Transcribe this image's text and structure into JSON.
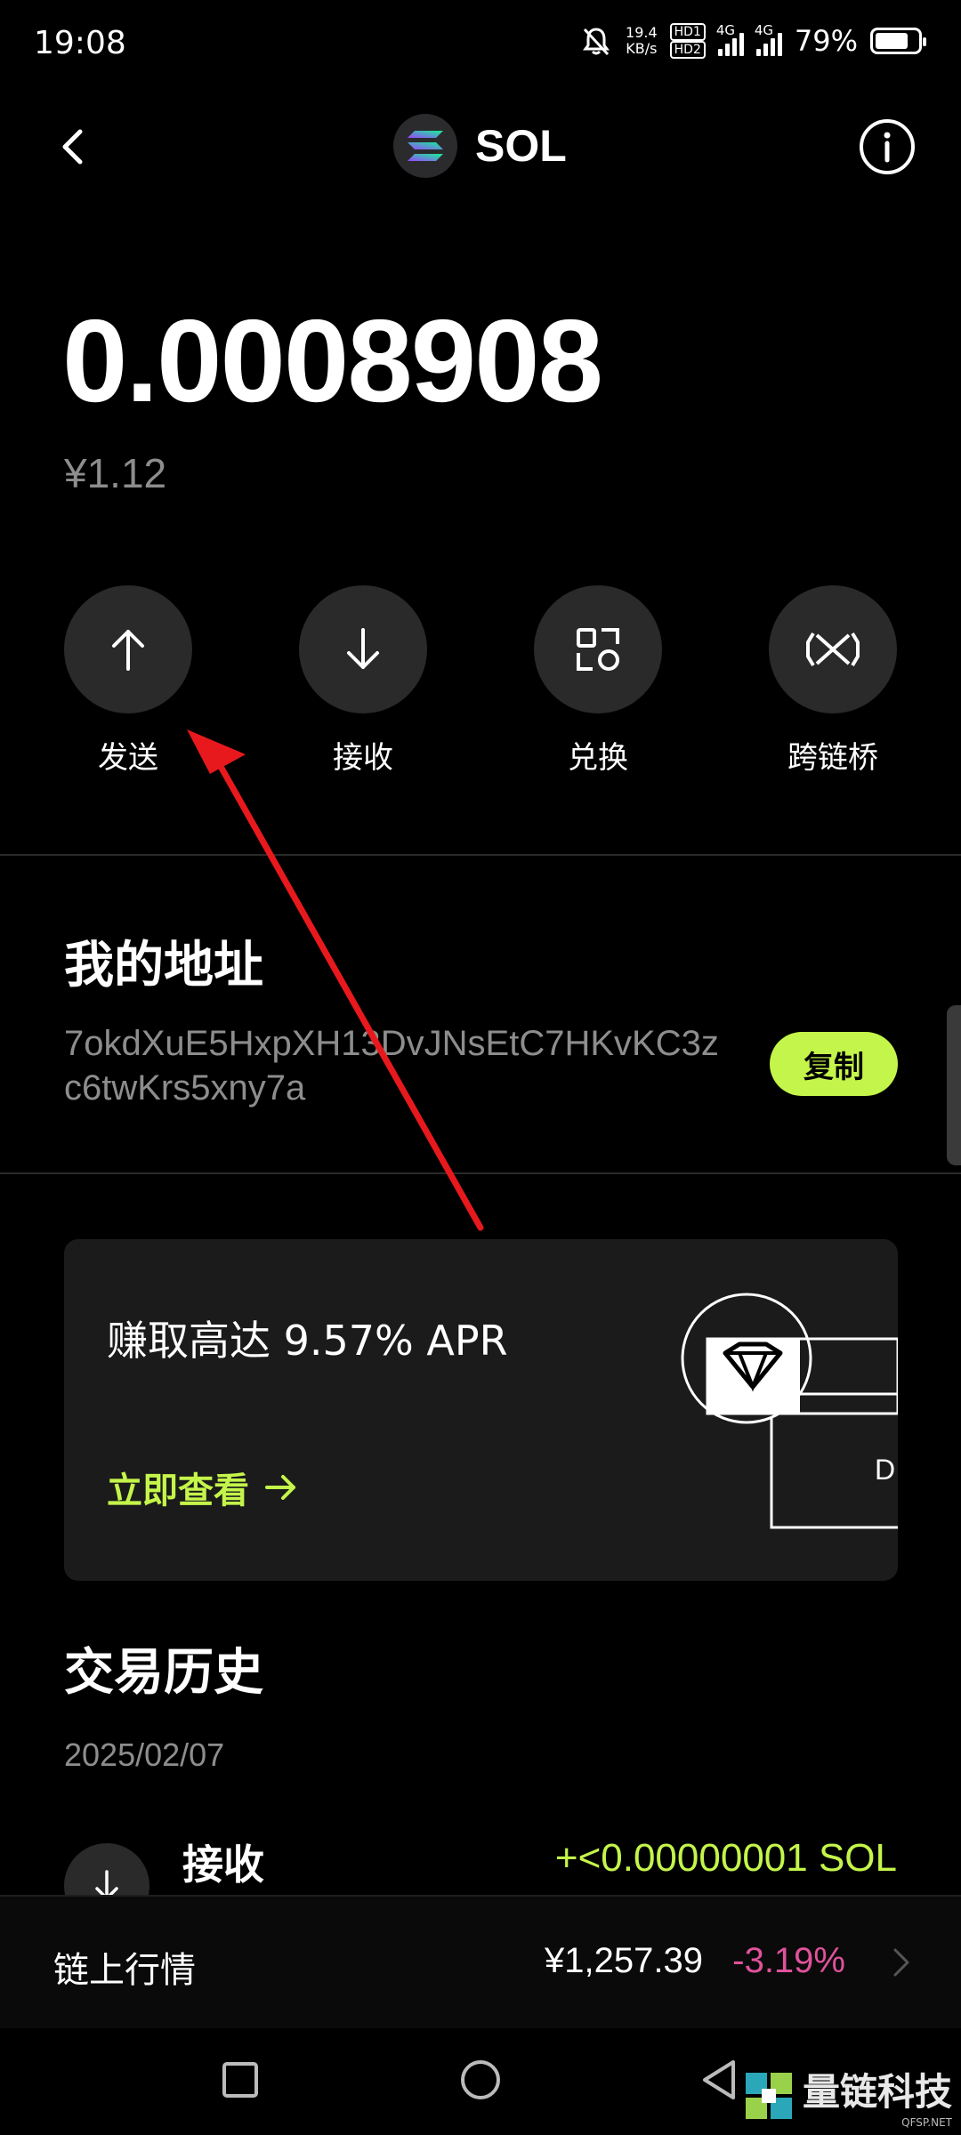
{
  "status_bar": {
    "time": "19:08",
    "net_speed_value": "19.4",
    "net_speed_unit": "KB/s",
    "hd_badge_1": "HD1",
    "hd_badge_2": "HD2",
    "sim1_type": "4G",
    "sim2_type": "4G",
    "battery_percent": "79%",
    "battery_level": 0.79
  },
  "header": {
    "title": "SOL",
    "back_icon": "chevron-left-icon",
    "info_icon": "info-icon",
    "logo_icon": "solana-logo-icon"
  },
  "balance": {
    "amount": "0.0008908",
    "fiat": "¥1.12"
  },
  "actions": [
    {
      "label": "发送",
      "icon": "arrow-up-icon"
    },
    {
      "label": "接收",
      "icon": "arrow-down-icon"
    },
    {
      "label": "兑换",
      "icon": "swap-icon"
    },
    {
      "label": "跨链桥",
      "icon": "bridge-icon"
    }
  ],
  "address": {
    "title": "我的地址",
    "value": "7okdXuE5HxpXH13DvJNsEtC7HKvKC3zc6twKrs5xny7a",
    "copy_label": "复制"
  },
  "promo": {
    "text": "赚取高达 9.57% APR",
    "link_label": "立即查看",
    "art_icon": "diamond-icon"
  },
  "history": {
    "title": "交易历史",
    "date": "2025/02/07",
    "transactions": [
      {
        "label": "接收",
        "amount": "+<0.00000001 SOL",
        "icon": "arrow-down-icon"
      }
    ]
  },
  "market": {
    "label": "链上行情",
    "price": "¥1,257.39",
    "change": "-3.19%",
    "change_color": "#e0529c"
  },
  "nav": {
    "recent": "square-icon",
    "home": "circle-icon",
    "back": "triangle-back-icon"
  },
  "watermark": {
    "text": "量链科技",
    "sub": "QFSP.NET"
  },
  "colors": {
    "accent": "#c4f54a",
    "background": "#000000",
    "annotation_arrow": "#e8191c"
  }
}
